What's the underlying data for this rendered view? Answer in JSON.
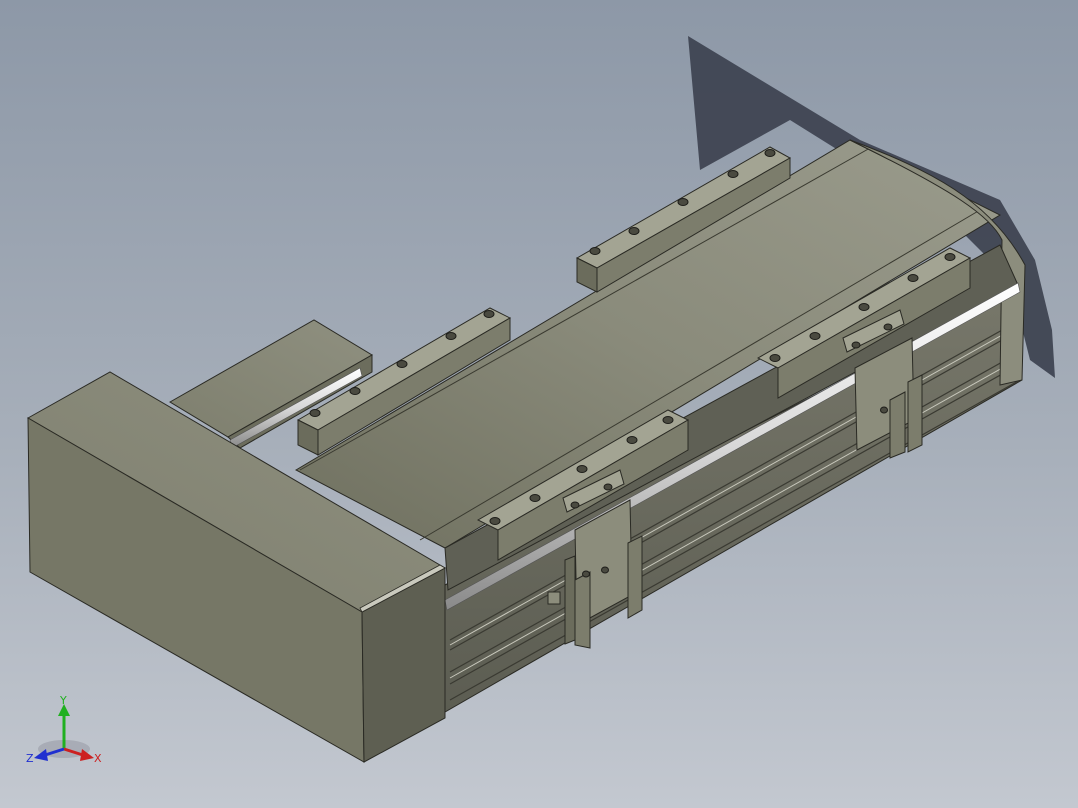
{
  "app": {
    "view": "isometric-shaded-with-edges",
    "background_colors": [
      "#8d98a7",
      "#c3c8d0"
    ]
  },
  "model": {
    "name": "",
    "body_color": "#7d7e6c",
    "shadow_color": "#3e4350",
    "rail_color": "#e6e6e6"
  },
  "triad": {
    "x_label": "X",
    "y_label": "Y",
    "z_label": "Z",
    "x_color": "#cc2020",
    "y_color": "#20b020",
    "z_color": "#2030d0"
  }
}
